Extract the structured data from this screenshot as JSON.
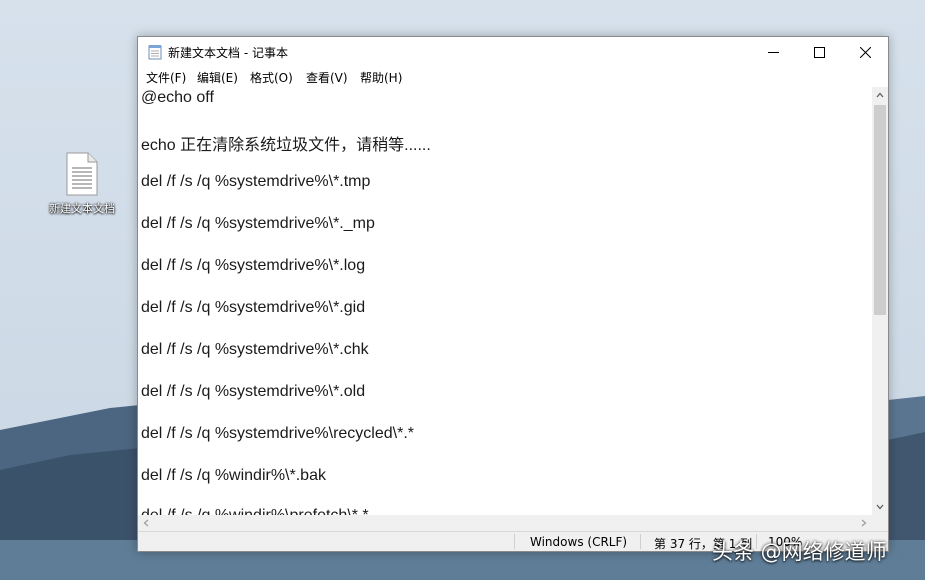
{
  "desktop": {
    "icon_label": "新建文本文档"
  },
  "window": {
    "title": "新建文本文档 - 记事本",
    "controls": {
      "minimize": "—",
      "maximize": "☐",
      "close": "✕"
    }
  },
  "menu": {
    "items": [
      {
        "label": "文件(F)"
      },
      {
        "label": "编辑(E)"
      },
      {
        "label": "格式(O)"
      },
      {
        "label": "查看(V)"
      },
      {
        "label": "帮助(H)"
      }
    ]
  },
  "editor": {
    "lines": [
      "@echo off",
      "echo 正在清除系统垃圾文件，请稍等......",
      "del /f /s /q %systemdrive%\\*.tmp",
      "del /f /s /q %systemdrive%\\*._mp",
      "del /f /s /q %systemdrive%\\*.log",
      "del /f /s /q %systemdrive%\\*.gid",
      "del /f /s /q %systemdrive%\\*.chk",
      "del /f /s /q %systemdrive%\\*.old",
      "del /f /s /q %systemdrive%\\recycled\\*.*",
      "del /f /s /q %windir%\\*.bak",
      "del /f /s /q %windir%\\prefetch\\*.*"
    ]
  },
  "statusbar": {
    "line_ending": "Windows (CRLF)",
    "position": "第 37 行，第 1 列",
    "zoom": "100%"
  },
  "watermark": "头条 @网络修道师",
  "colors": {
    "window_bg": "#ffffff",
    "chrome_bg": "#f0f0f0",
    "text": "#1a1a1a"
  }
}
